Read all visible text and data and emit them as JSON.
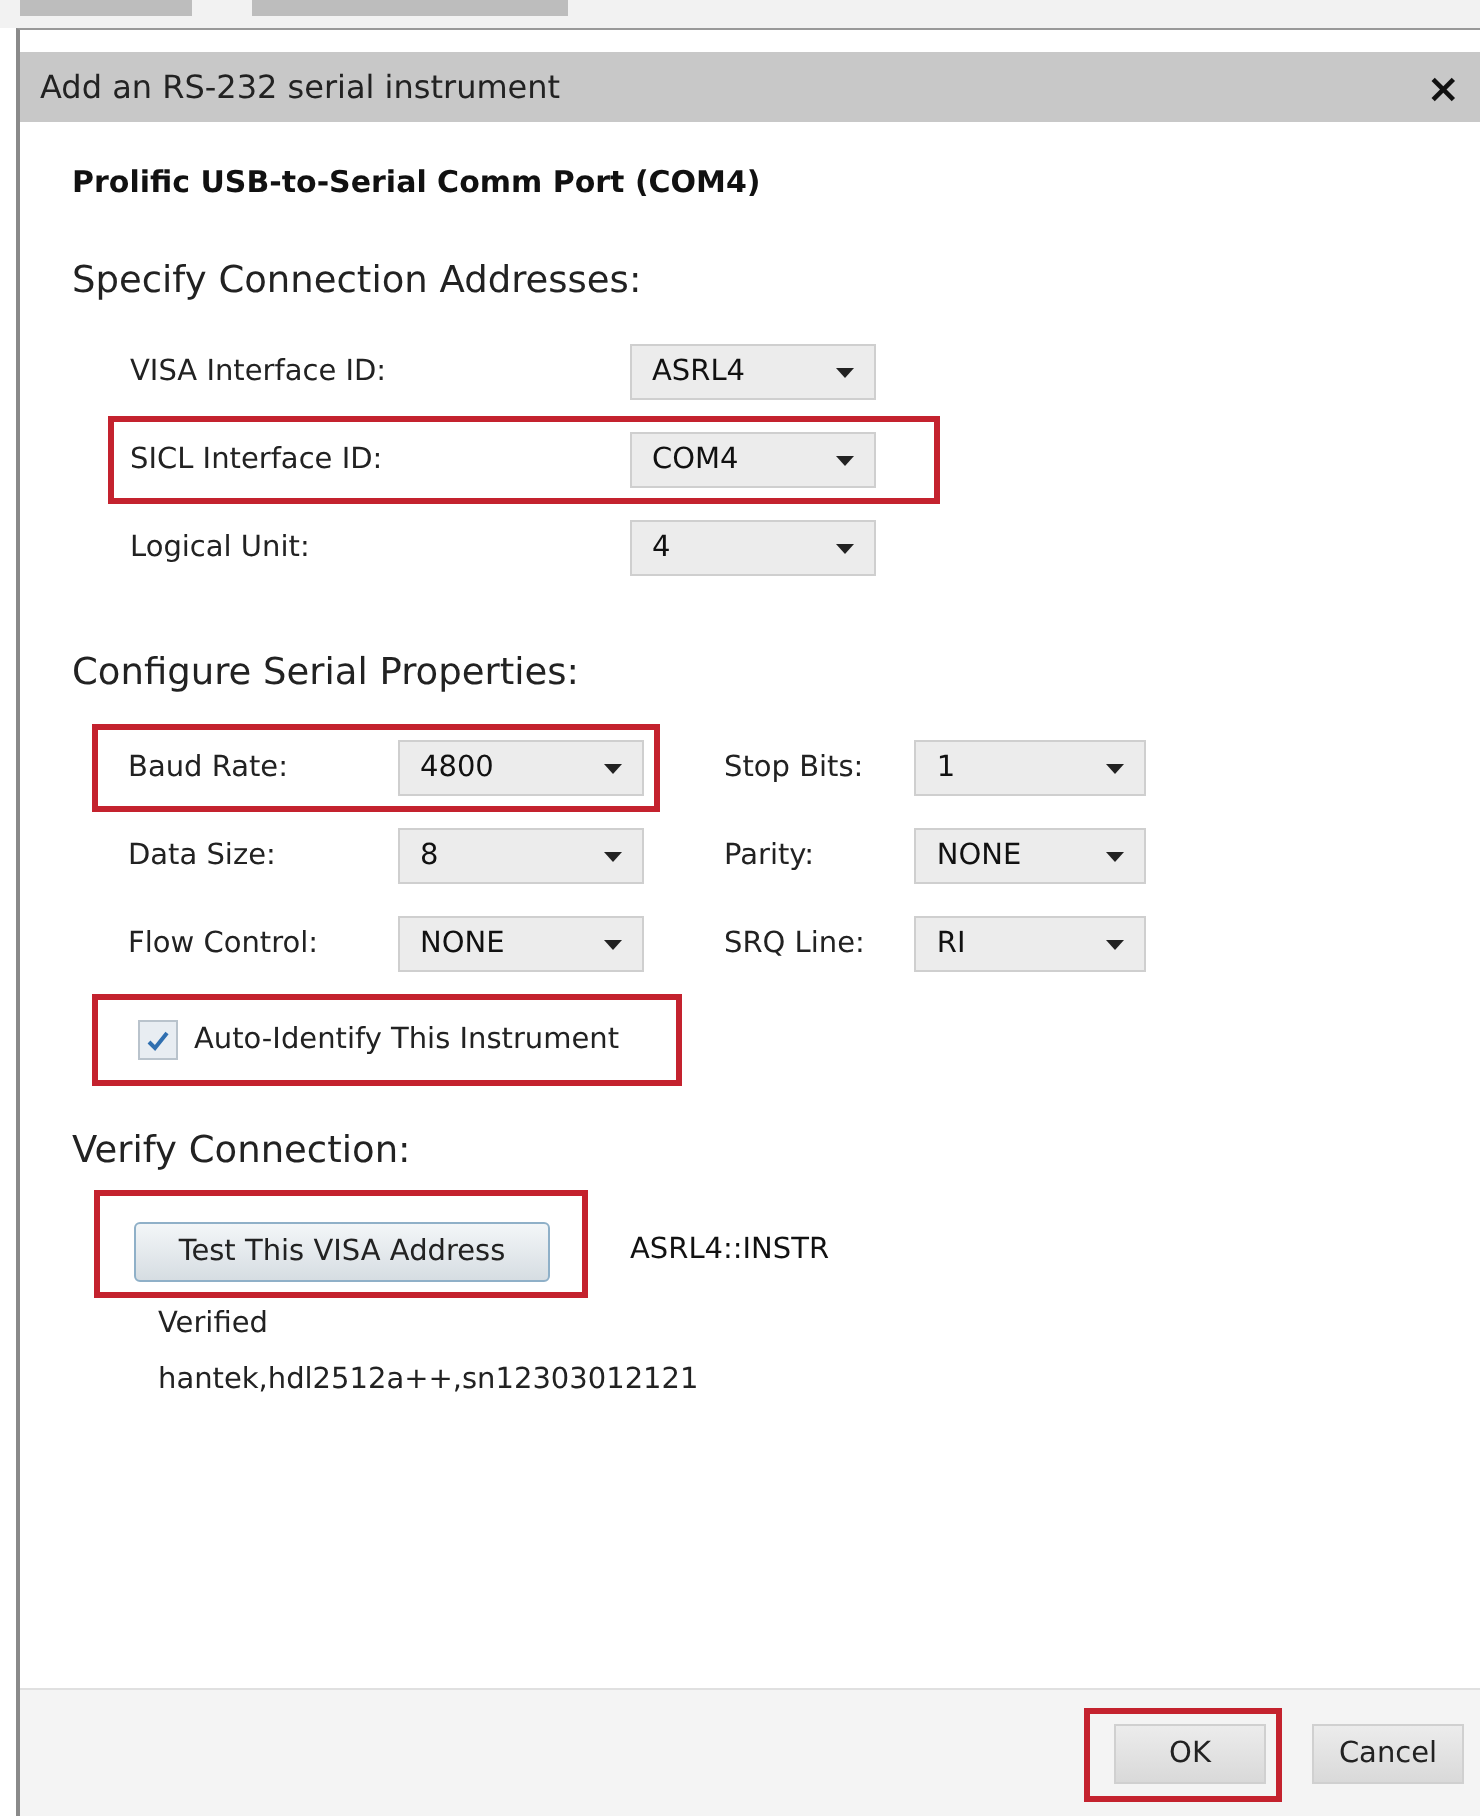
{
  "window": {
    "title": "Add an RS-232 serial instrument",
    "close": "×"
  },
  "device": "Prolific USB-to-Serial Comm Port (COM4)",
  "addresses": {
    "heading": "Specify Connection Addresses:",
    "fields": [
      {
        "label": "VISA Interface ID:",
        "value": "ASRL4",
        "highlighted": false
      },
      {
        "label": "SICL Interface ID:",
        "value": "COM4",
        "highlighted": true
      },
      {
        "label": "Logical Unit:",
        "value": "4",
        "highlighted": false
      }
    ]
  },
  "serial": {
    "heading": "Configure Serial Properties:",
    "fields": [
      {
        "label": "Baud Rate:",
        "value": "4800",
        "highlighted": true
      },
      {
        "label": "Stop Bits:",
        "value": "1",
        "highlighted": false
      },
      {
        "label": "Data Size:",
        "value": "8",
        "highlighted": false
      },
      {
        "label": "Parity:",
        "value": "NONE",
        "highlighted": false
      },
      {
        "label": "Flow Control:",
        "value": "NONE",
        "highlighted": false
      },
      {
        "label": "SRQ Line:",
        "value": "RI",
        "highlighted": false
      }
    ],
    "auto_identify": {
      "label": "Auto-Identify This Instrument",
      "checked": true,
      "highlighted": true
    }
  },
  "verify": {
    "heading": "Verify Connection:",
    "button": {
      "label": "Test This VISA Address",
      "highlighted": true
    },
    "address": "ASRL4::INSTR",
    "status": "Verified",
    "response": "hantek,hdl2512a++,sn12303012121"
  },
  "buttons": [
    {
      "label": "OK",
      "highlighted": true
    },
    {
      "label": "Cancel",
      "highlighted": false
    }
  ]
}
